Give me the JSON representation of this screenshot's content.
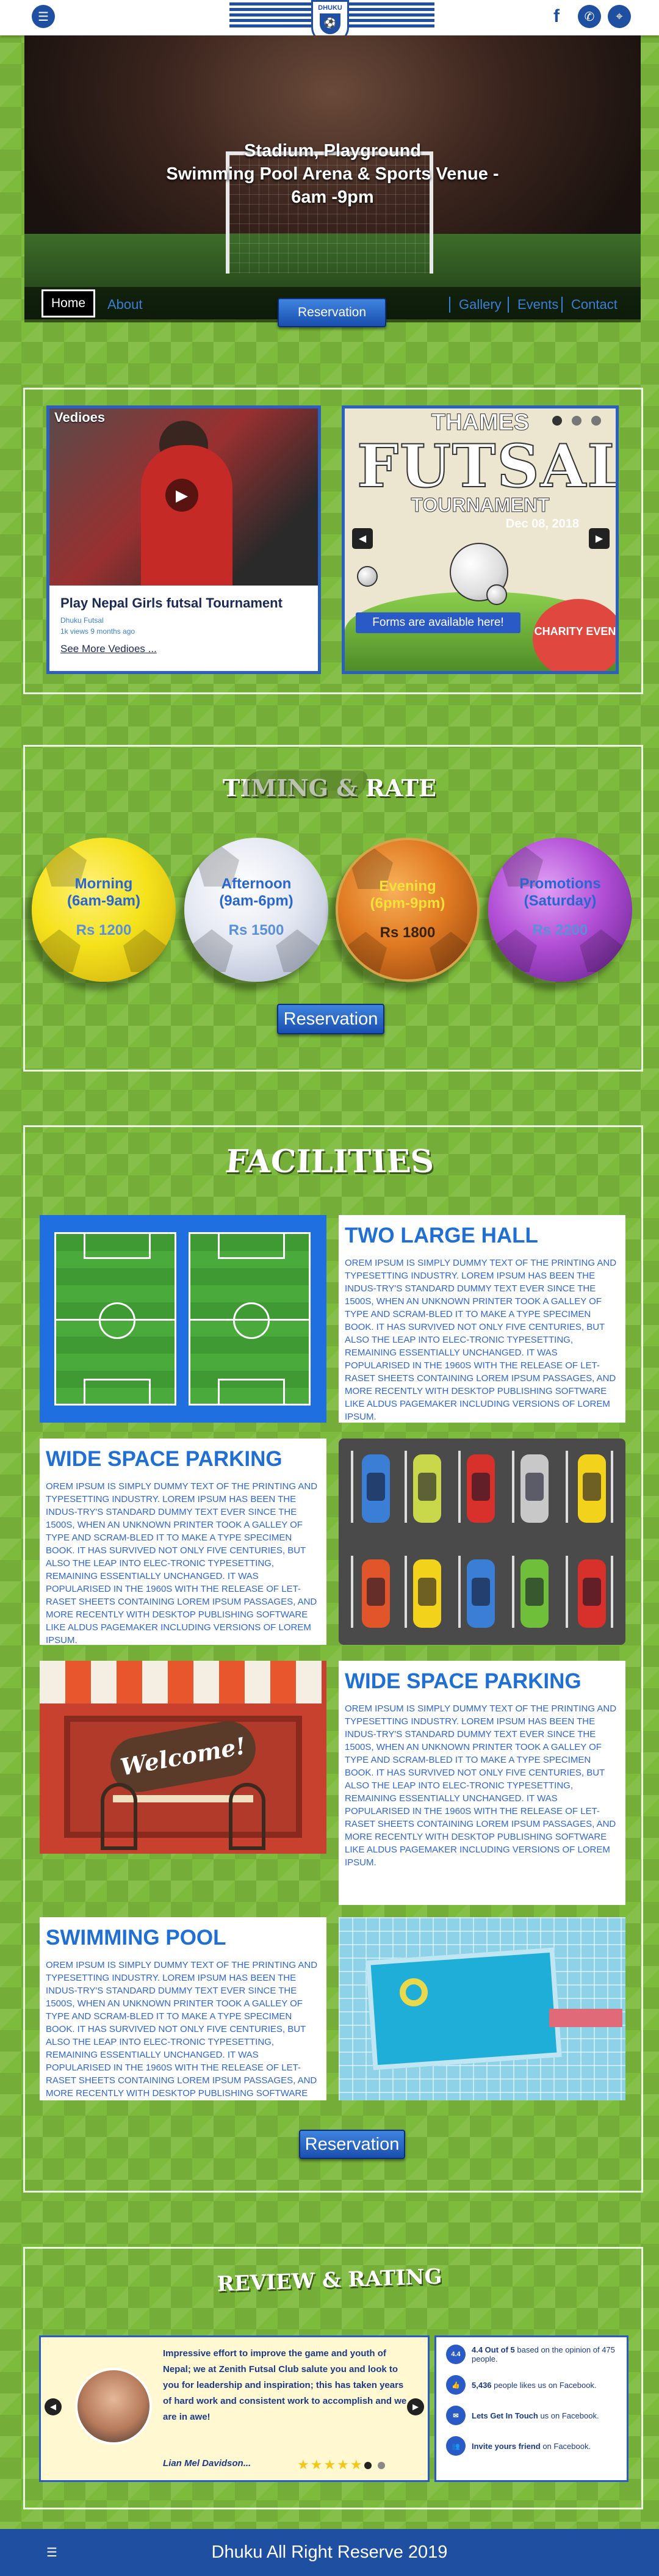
{
  "header": {
    "logo_text": "DHUKU",
    "logo_subtext": "FUTSAL CLUB",
    "menu_icon": "menu-icon",
    "social_icons": [
      "facebook-icon",
      "whatsapp-icon",
      "location-pin-icon"
    ]
  },
  "hero": {
    "line1": "Stadium, Playground",
    "line2": "Swimming Pool Arena & Sports Venue -",
    "line3": "6am -9pm"
  },
  "nav": {
    "home": "Home",
    "about": "About",
    "reservation": "Reservation",
    "gallery": "Gallery",
    "events": "Events",
    "contact": "Contact"
  },
  "videos": {
    "tag": "Vedioes",
    "title": "Play Nepal Girls futsal Tournament",
    "channel": "Dhuku Futsal",
    "meta": "1k views 9 months ago",
    "more": "See More Vedioes ..."
  },
  "flyer": {
    "line1": "THAMES",
    "line2": "FUTSAL",
    "line3": "TOURNAMENT",
    "date": "Dec 08, 2018",
    "forms": "Forms are available here!",
    "charity": "CHARITY EVENT"
  },
  "timing": {
    "title": "TIMING & RATE",
    "slots": [
      {
        "label": "Morning",
        "time": "(6am-9am)",
        "price": "Rs 1200",
        "color": "#f5e21b"
      },
      {
        "label": "Afternoon",
        "time": "(9am-6pm)",
        "price": "Rs 1500",
        "color": "#e4e8f2"
      },
      {
        "label": "Evening",
        "time": "(6pm-9pm)",
        "price": "Rs 1800",
        "color": "#e07a22"
      },
      {
        "label": "Promotions",
        "time": "(Saturday)",
        "price": "Rs 2200",
        "color": "#b24fd6"
      }
    ],
    "reservation": "Reservation"
  },
  "facilities": {
    "title": "FACILITIES",
    "items": [
      {
        "title": "TWO LARGE HALL",
        "text": "OREM IPSUM IS SIMPLY DUMMY TEXT OF THE PRINTING AND TYPESETTING INDUSTRY. LOREM IPSUM HAS BEEN THE INDUS-TRY'S STANDARD DUMMY TEXT EVER SINCE THE 1500S, WHEN AN UNKNOWN PRINTER TOOK A GALLEY OF TYPE AND SCRAM-BLED IT TO MAKE A TYPE SPECIMEN BOOK. IT HAS SURVIVED NOT ONLY FIVE CENTURIES, BUT ALSO THE LEAP INTO ELEC-TRONIC TYPESETTING, REMAINING ESSENTIALLY UNCHANGED. IT WAS POPULARISED IN THE 1960S WITH THE RELEASE OF LET-RASET SHEETS CONTAINING LOREM IPSUM PASSAGES, AND MORE RECENTLY WITH DESKTOP PUBLISHING SOFTWARE LIKE ALDUS PAGEMAKER INCLUDING VERSIONS OF LOREM IPSUM."
      },
      {
        "title": "WIDE SPACE PARKING",
        "text": "OREM IPSUM IS SIMPLY DUMMY TEXT OF THE PRINTING AND TYPESETTING INDUSTRY. LOREM IPSUM HAS BEEN THE INDUS-TRY'S STANDARD DUMMY TEXT EVER SINCE THE 1500S, WHEN AN UNKNOWN PRINTER TOOK A GALLEY OF TYPE AND SCRAM-BLED IT TO MAKE A TYPE SPECIMEN BOOK. IT HAS SURVIVED NOT ONLY FIVE CENTURIES, BUT ALSO THE LEAP INTO ELEC-TRONIC TYPESETTING, REMAINING ESSENTIALLY UNCHANGED. IT WAS POPULARISED IN THE 1960S WITH THE RELEASE OF LET-RASET SHEETS CONTAINING LOREM IPSUM PASSAGES, AND MORE RECENTLY WITH DESKTOP PUBLISHING SOFTWARE LIKE ALDUS PAGEMAKER INCLUDING VERSIONS OF LOREM IPSUM."
      },
      {
        "title": "WIDE SPACE PARKING",
        "text": "OREM IPSUM IS SIMPLY DUMMY TEXT OF THE PRINTING AND TYPESETTING INDUSTRY. LOREM IPSUM HAS BEEN THE INDUS-TRY'S STANDARD DUMMY TEXT EVER SINCE THE 1500S, WHEN AN UNKNOWN PRINTER TOOK A GALLEY OF TYPE AND SCRAM-BLED IT TO MAKE A TYPE SPECIMEN BOOK. IT HAS SURVIVED NOT ONLY FIVE CENTURIES, BUT ALSO THE LEAP INTO ELEC-TRONIC TYPESETTING, REMAINING ESSENTIALLY UNCHANGED. IT WAS POPULARISED IN THE 1960S WITH THE RELEASE OF LET-RASET SHEETS CONTAINING LOREM IPSUM PASSAGES, AND MORE RECENTLY WITH DESKTOP PUBLISHING SOFTWARE LIKE ALDUS PAGEMAKER INCLUDING VERSIONS OF LOREM IPSUM."
      },
      {
        "title": "SWIMMING POOL",
        "text": "OREM IPSUM IS SIMPLY DUMMY TEXT OF THE PRINTING AND TYPESETTING INDUSTRY. LOREM IPSUM HAS BEEN THE INDUS-TRY'S STANDARD DUMMY TEXT EVER SINCE THE 1500S, WHEN AN UNKNOWN PRINTER TOOK A GALLEY OF TYPE AND SCRAM-BLED IT TO MAKE A TYPE SPECIMEN BOOK. IT HAS SURVIVED NOT ONLY FIVE CENTURIES, BUT ALSO THE LEAP INTO ELEC-TRONIC TYPESETTING, REMAINING ESSENTIALLY UNCHANGED. IT WAS POPULARISED IN THE 1960S WITH THE RELEASE OF LET-RASET SHEETS CONTAINING LOREM IPSUM PASSAGES, AND MORE RECENTLY WITH DESKTOP PUBLISHING SOFTWARE LIKE"
      }
    ],
    "cafe_sign": "Welcome!",
    "reservation": "Reservation"
  },
  "review": {
    "title": "REVIEW & RATING",
    "quote": "Impressive effort to improve the game and youth of Nepal; we at Zenith Futsal Club salute you and look to you for leadership and inspiration; this has taken years of hard work and consistent work to accomplish and we are in awe!",
    "author": "Lian Mel Davidson...",
    "stars": "★★★★★",
    "fb": [
      {
        "icon": "4.4",
        "bold": "4.4 Out of 5",
        "text": " based on the opinion of 475 people."
      },
      {
        "icon": "like-icon",
        "bold": "5,436",
        "text": " people likes us on Facebook."
      },
      {
        "icon": "messenger-icon",
        "bold": "Lets Get In Touch",
        "text": " us on Facebook."
      },
      {
        "icon": "friends-icon",
        "bold": "Invite yours friend",
        "text": " on Facebook."
      }
    ]
  },
  "footer": {
    "text": "Dhuku All Right Reserve 2019"
  },
  "colors": {
    "brand_blue": "#1f4fa0",
    "accent_blue": "#2a66d0",
    "grass": "#7dbb3c"
  }
}
